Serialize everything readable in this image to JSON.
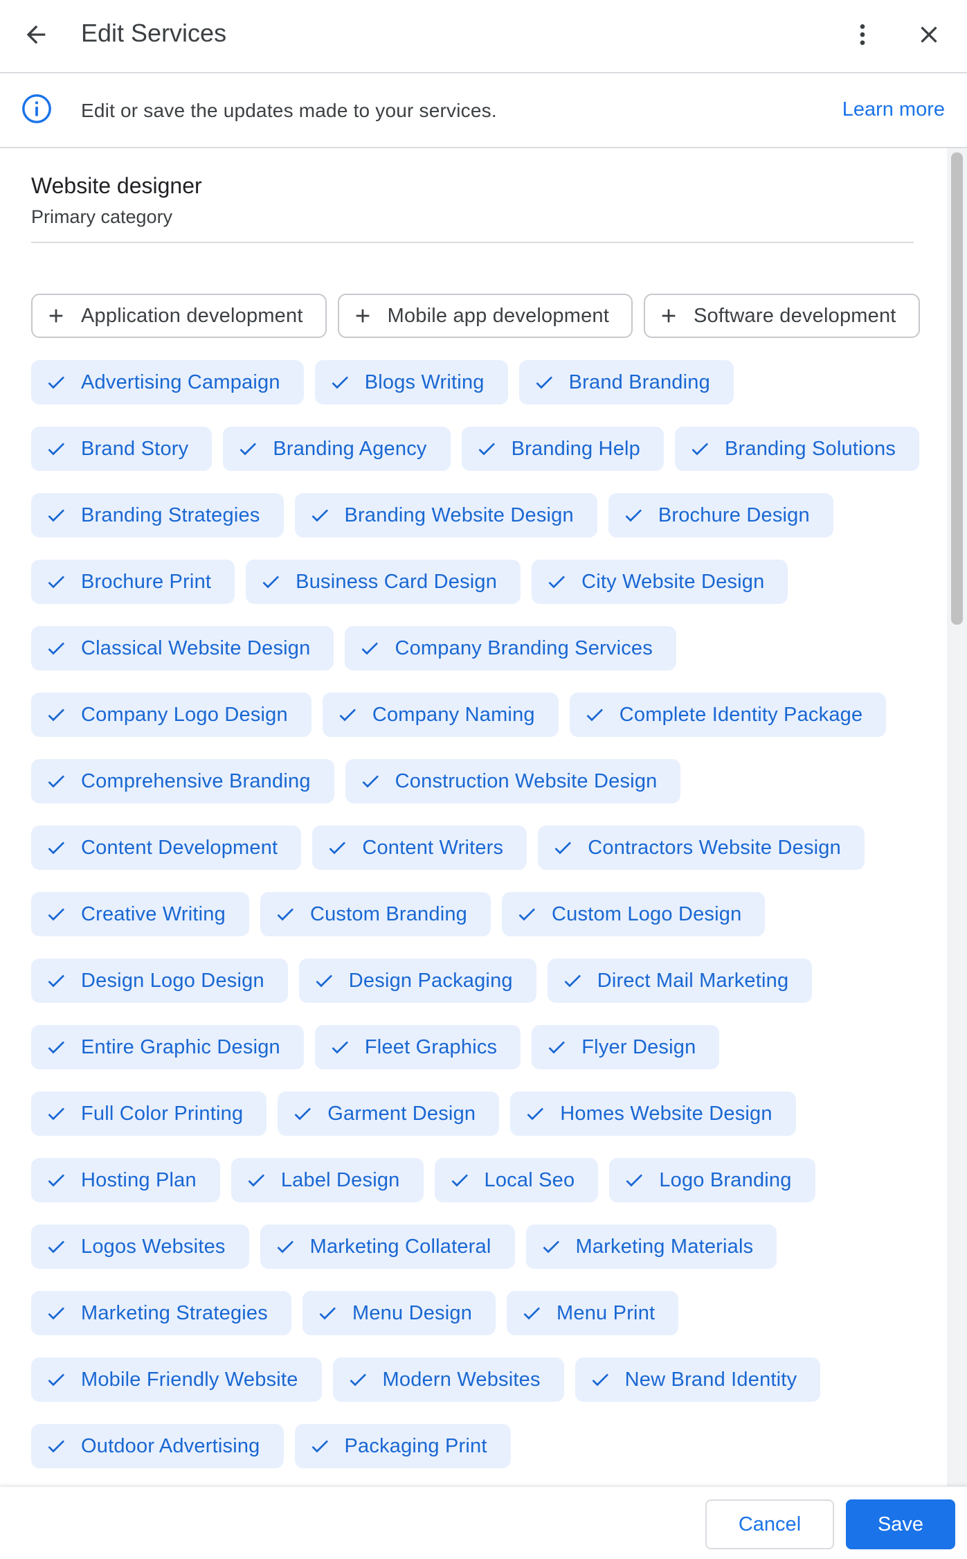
{
  "header": {
    "title": "Edit Services",
    "back_icon": "arrow-left-icon",
    "more_icon": "more-vert-icon",
    "close_icon": "close-icon"
  },
  "info": {
    "icon": "info-icon",
    "text": "Edit or save the updates made to your services.",
    "link": "Learn more"
  },
  "category": {
    "name": "Website designer",
    "subtitle": "Primary category"
  },
  "colors": {
    "accent": "#1a73e8",
    "chip_selected_bg": "#e8f0fe",
    "chip_selected_text": "#1967d2"
  },
  "suggested_services": [
    "Application development",
    "Mobile app development",
    "Software development"
  ],
  "selected_services": [
    "Advertising Campaign",
    "Blogs Writing",
    "Brand Branding",
    "Brand Story",
    "Branding Agency",
    "Branding Help",
    "Branding Solutions",
    "Branding Strategies",
    "Branding Website Design",
    "Brochure Design",
    "Brochure Print",
    "Business Card Design",
    "City Website Design",
    "Classical Website Design",
    "Company Branding Services",
    "Company Logo Design",
    "Company Naming",
    "Complete Identity Package",
    "Comprehensive Branding",
    "Construction Website Design",
    "Content Development",
    "Content Writers",
    "Contractors Website Design",
    "Creative Writing",
    "Custom Branding",
    "Custom Logo Design",
    "Design Logo Design",
    "Design Packaging",
    "Direct Mail Marketing",
    "Entire Graphic Design",
    "Fleet Graphics",
    "Flyer Design",
    "Full Color Printing",
    "Garment Design",
    "Homes Website Design",
    "Hosting Plan",
    "Label Design",
    "Local Seo",
    "Logo Branding",
    "Logos Websites",
    "Marketing Collateral",
    "Marketing Materials",
    "Marketing Strategies",
    "Menu Design",
    "Menu Print",
    "Mobile Friendly Website",
    "Modern Websites",
    "New Brand Identity",
    "Outdoor Advertising",
    "Packaging Print"
  ],
  "footer": {
    "cancel": "Cancel",
    "save": "Save"
  }
}
